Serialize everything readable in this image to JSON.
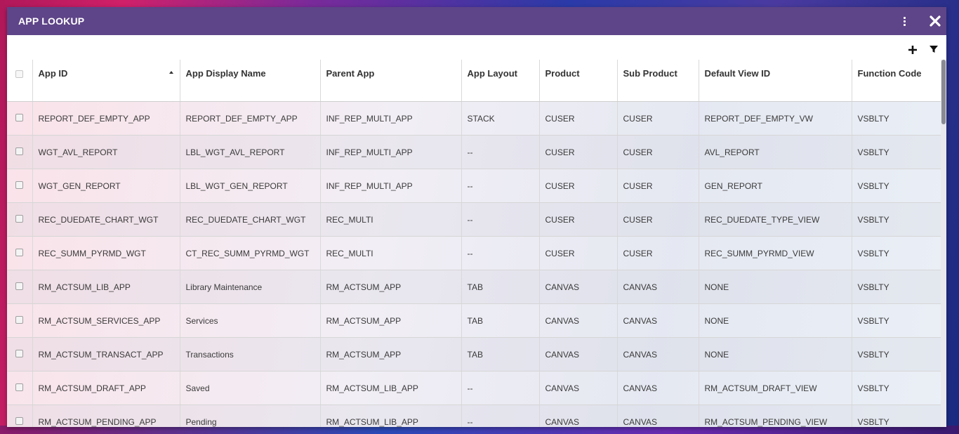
{
  "window": {
    "title": "APP LOOKUP",
    "accent_color": "#5e4488",
    "icons": {
      "menu": "kebab-vertical-icon",
      "close": "close-x-icon",
      "add": "plus-icon",
      "filter": "funnel-filter-icon"
    }
  },
  "table": {
    "columns": [
      {
        "label": "App ID",
        "sorted": "ascending"
      },
      {
        "label": "App Display Name"
      },
      {
        "label": "Parent App"
      },
      {
        "label": "App Layout"
      },
      {
        "label": "Product"
      },
      {
        "label": "Sub Product"
      },
      {
        "label": "Default View ID"
      },
      {
        "label": "Function Code"
      }
    ],
    "rows": [
      [
        "REPORT_DEF_EMPTY_APP",
        "REPORT_DEF_EMPTY_APP",
        "INF_REP_MULTI_APP",
        "STACK",
        "CUSER",
        "CUSER",
        "REPORT_DEF_EMPTY_VW",
        "VSBLTY"
      ],
      [
        "WGT_AVL_REPORT",
        "LBL_WGT_AVL_REPORT",
        "INF_REP_MULTI_APP",
        "--",
        "CUSER",
        "CUSER",
        "AVL_REPORT",
        "VSBLTY"
      ],
      [
        "WGT_GEN_REPORT",
        "LBL_WGT_GEN_REPORT",
        "INF_REP_MULTI_APP",
        "--",
        "CUSER",
        "CUSER",
        "GEN_REPORT",
        "VSBLTY"
      ],
      [
        "REC_DUEDATE_CHART_WGT",
        "REC_DUEDATE_CHART_WGT",
        "REC_MULTI",
        "--",
        "CUSER",
        "CUSER",
        "REC_DUEDATE_TYPE_VIEW",
        "VSBLTY"
      ],
      [
        "REC_SUMM_PYRMD_WGT",
        "CT_REC_SUMM_PYRMD_WGT",
        "REC_MULTI",
        "--",
        "CUSER",
        "CUSER",
        "REC_SUMM_PYRMD_VIEW",
        "VSBLTY"
      ],
      [
        "RM_ACTSUM_LIB_APP",
        "Library Maintenance",
        "RM_ACTSUM_APP",
        "TAB",
        "CANVAS",
        "CANVAS",
        "NONE",
        "VSBLTY"
      ],
      [
        "RM_ACTSUM_SERVICES_APP",
        "Services",
        "RM_ACTSUM_APP",
        "TAB",
        "CANVAS",
        "CANVAS",
        "NONE",
        "VSBLTY"
      ],
      [
        "RM_ACTSUM_TRANSACT_APP",
        "Transactions",
        "RM_ACTSUM_APP",
        "TAB",
        "CANVAS",
        "CANVAS",
        "NONE",
        "VSBLTY"
      ],
      [
        "RM_ACTSUM_DRAFT_APP",
        "Saved",
        "RM_ACTSUM_LIB_APP",
        "--",
        "CANVAS",
        "CANVAS",
        "RM_ACTSUM_DRAFT_VIEW",
        "VSBLTY"
      ],
      [
        "RM_ACTSUM_PENDING_APP",
        "Pending",
        "RM_ACTSUM_LIB_APP",
        "--",
        "CANVAS",
        "CANVAS",
        "RM_ACTSUM_PENDING_VIEW",
        "VSBLTY"
      ]
    ]
  }
}
